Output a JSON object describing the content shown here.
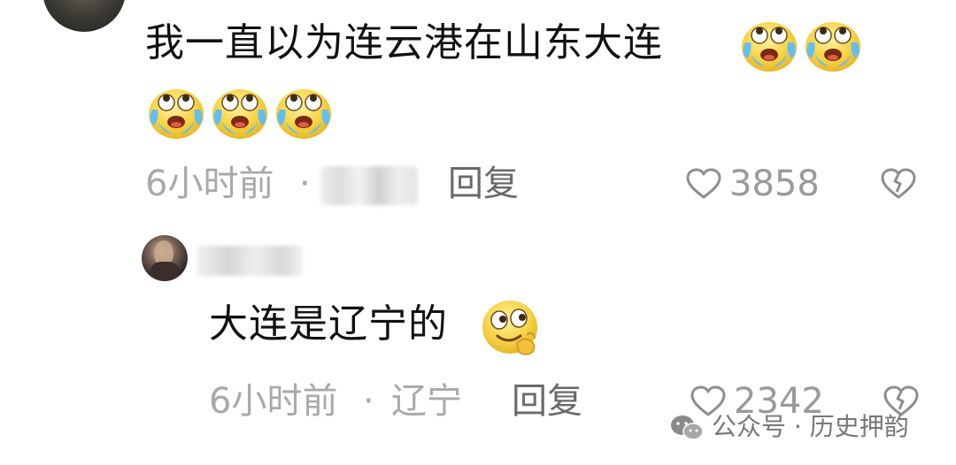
{
  "comment": {
    "text": "我一直以为连云港在山东大连",
    "emojis": [
      "laugh-cry",
      "laugh-cry",
      "laugh-cry",
      "laugh-cry",
      "laugh-cry"
    ],
    "time": "6小时前",
    "separator": "·",
    "reply_label": "回复",
    "likes": "3858"
  },
  "reply": {
    "text": "大连是辽宁的",
    "emoji": "smirk-thinking",
    "time": "6小时前",
    "separator": "·",
    "location": "辽宁",
    "reply_label": "回复",
    "likes": "2342"
  },
  "watermark": {
    "text": "公众号 · 历史押韵"
  },
  "colors": {
    "text": "#111111",
    "meta": "#a9a9a9",
    "emoji_face": "#f9d84a",
    "tears": "#6fc6f0"
  },
  "icons": [
    "heart-outline-icon",
    "broken-heart-icon",
    "wechat-icon"
  ]
}
